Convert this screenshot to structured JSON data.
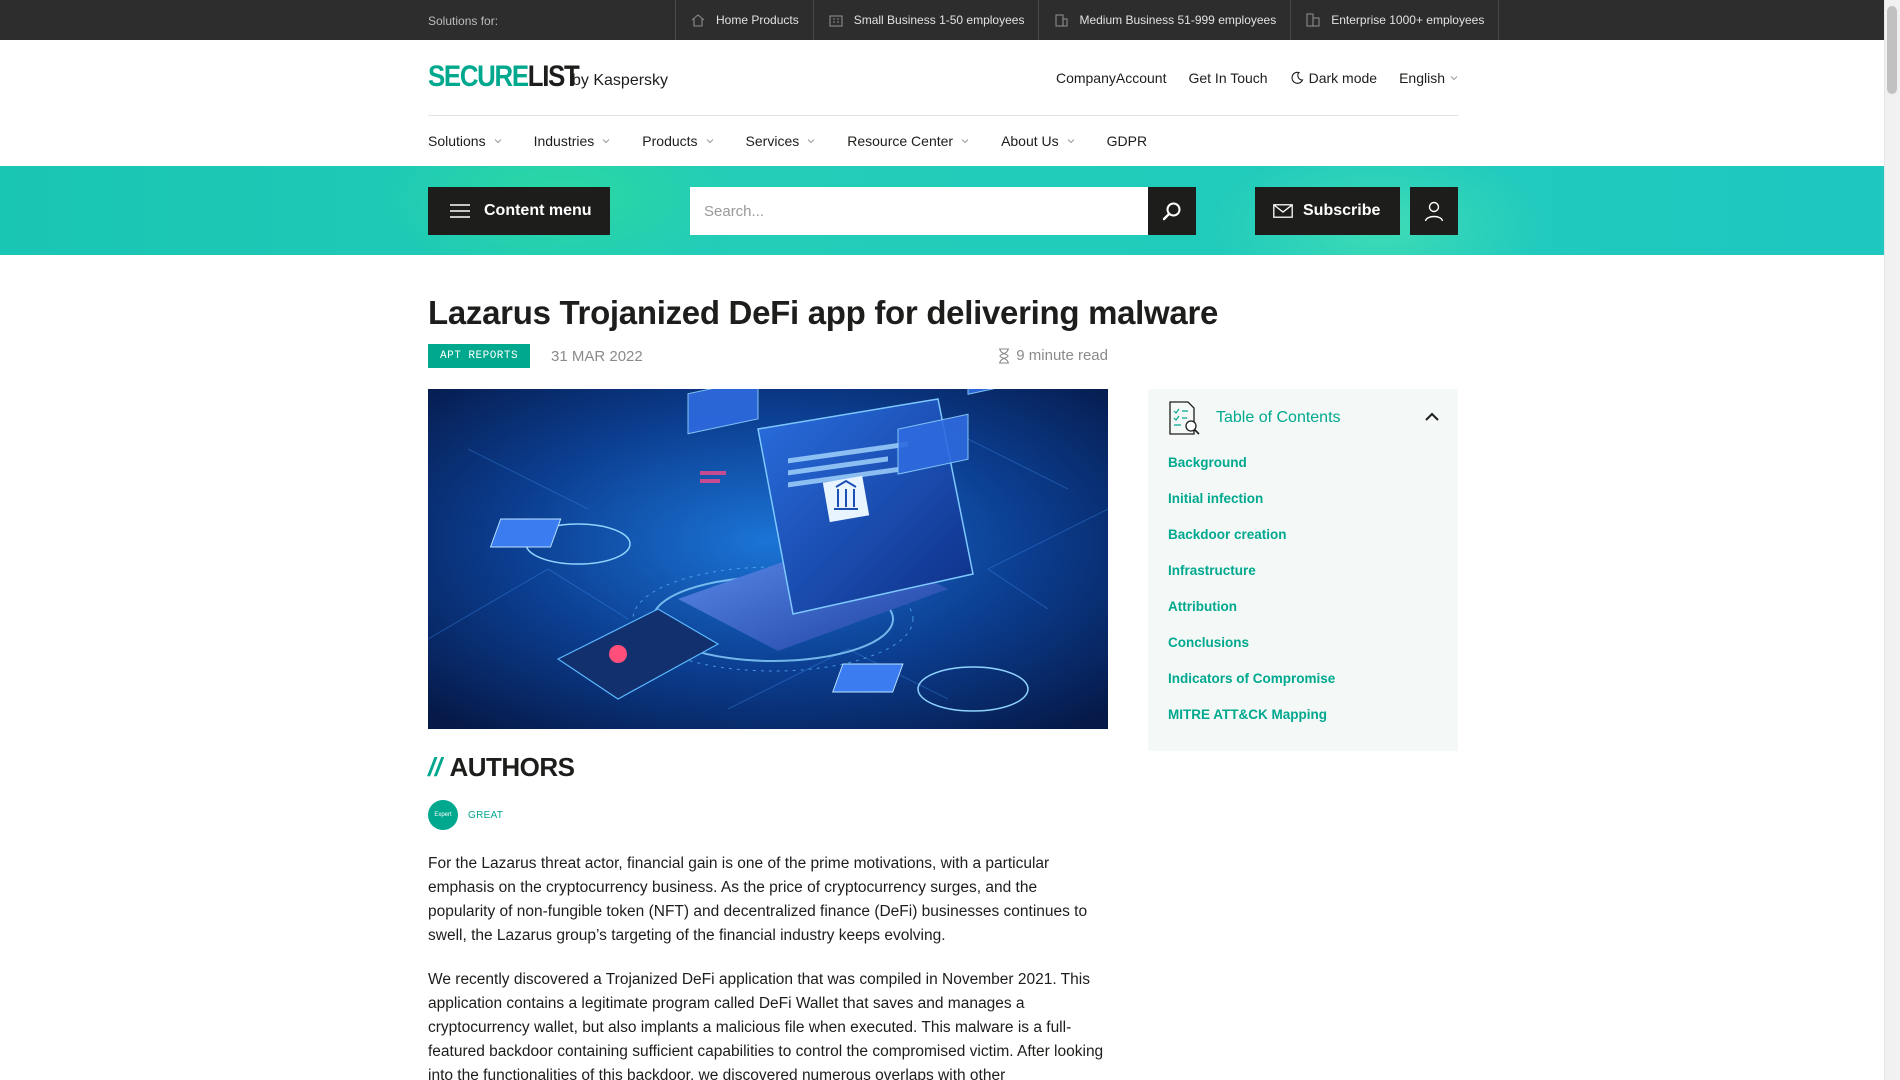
{
  "topbar": {
    "solutions_label": "Solutions for:",
    "segments": [
      {
        "label": "Home Products",
        "icon": "house-icon"
      },
      {
        "label": "Small Business 1-50 employees",
        "icon": "small-building-icon"
      },
      {
        "label": "Medium Business 51-999 employees",
        "icon": "medium-building-icon"
      },
      {
        "label": "Enterprise 1000+ employees",
        "icon": "enterprise-building-icon"
      }
    ]
  },
  "header": {
    "logo_secure": "SECURE",
    "logo_list": "LIST",
    "logo_by": "by Kaspersky",
    "links": {
      "company_account": "CompanyAccount",
      "get_in_touch": "Get In Touch",
      "dark_mode": "Dark mode",
      "language": "English"
    }
  },
  "nav": {
    "items": [
      {
        "label": "Solutions",
        "dropdown": true
      },
      {
        "label": "Industries",
        "dropdown": true
      },
      {
        "label": "Products",
        "dropdown": true
      },
      {
        "label": "Services",
        "dropdown": true
      },
      {
        "label": "Resource Center",
        "dropdown": true
      },
      {
        "label": "About Us",
        "dropdown": true
      },
      {
        "label": "GDPR",
        "dropdown": false
      }
    ]
  },
  "band": {
    "content_menu_label": "Content menu",
    "search_placeholder": "Search...",
    "subscribe_label": "Subscribe"
  },
  "article": {
    "title": "Lazarus Trojanized DeFi app for delivering malware",
    "tag": "APT REPORTS",
    "date": "31 MAR 2022",
    "read_time": "9 minute read",
    "authors_slashes": "//",
    "authors_heading": "AUTHORS",
    "author_badge": "Expert",
    "author_name": "GREAT",
    "paragraphs": [
      "For the Lazarus threat actor, financial gain is one of the prime motivations, with a particular emphasis on the cryptocurrency business. As the price of cryptocurrency surges, and the popularity of non-fungible token (NFT) and decentralized finance (DeFi) businesses continues to swell, the Lazarus group’s targeting of the financial industry keeps evolving.",
      "We recently discovered a Trojanized DeFi application that was compiled in November 2021. This application contains a legitimate program called DeFi Wallet that saves and manages a cryptocurrency wallet, but also implants a malicious file when executed. This malware is a full-featured backdoor containing sufficient capabilities to control the compromised victim. After looking into the functionalities of this backdoor, we discovered numerous overlaps with other"
    ]
  },
  "toc": {
    "title": "Table of Contents",
    "items": [
      "Background",
      "Initial infection",
      "Backdoor creation",
      "Infrastructure",
      "Attribution",
      "Conclusions",
      "Indicators of Compromise",
      "MITRE ATT&CK Mapping"
    ]
  },
  "colors": {
    "accent": "#00a88e",
    "dark": "#1d1d1b",
    "topbar": "#2d2d2d",
    "band": "#1ec8b6"
  }
}
